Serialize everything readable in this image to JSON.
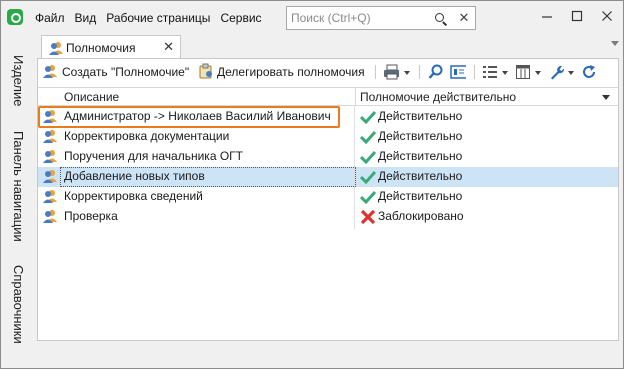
{
  "menu": {
    "items": [
      "Файл",
      "Вид",
      "Рабочие страницы",
      "Сервис"
    ]
  },
  "search": {
    "placeholder": "Поиск (Ctrl+Q)"
  },
  "side_nav": {
    "items": [
      "Изделие",
      "Панель навигации",
      "Справочники"
    ]
  },
  "tab": {
    "label": "Полномочия"
  },
  "toolbar": {
    "create_label": "Создать \"Полномочие\"",
    "delegate_label": "Делегировать полномочия"
  },
  "table": {
    "columns": [
      "Описание",
      "Полномочие действительно"
    ],
    "rows": [
      {
        "description": "Администратор -> Николаев Василий Иванович",
        "status": "Действительно",
        "status_kind": "valid"
      },
      {
        "description": "Корректировка документации",
        "status": "Действительно",
        "status_kind": "valid"
      },
      {
        "description": "Поручения для начальника ОГТ",
        "status": "Действительно",
        "status_kind": "valid"
      },
      {
        "description": "Добавление новых типов",
        "status": "Действительно",
        "status_kind": "valid"
      },
      {
        "description": "Корректировка сведений",
        "status": "Действительно",
        "status_kind": "valid"
      },
      {
        "description": "Проверка",
        "status": "Заблокировано",
        "status_kind": "blocked"
      }
    ],
    "selected_row": 3,
    "highlighted_row": 0
  },
  "colors": {
    "accent_green": "#2aa84a",
    "valid_check": "#3aa877",
    "blocked_x": "#e0302a",
    "selection": "#cde4f7",
    "highlight_box": "#e87c1e"
  }
}
